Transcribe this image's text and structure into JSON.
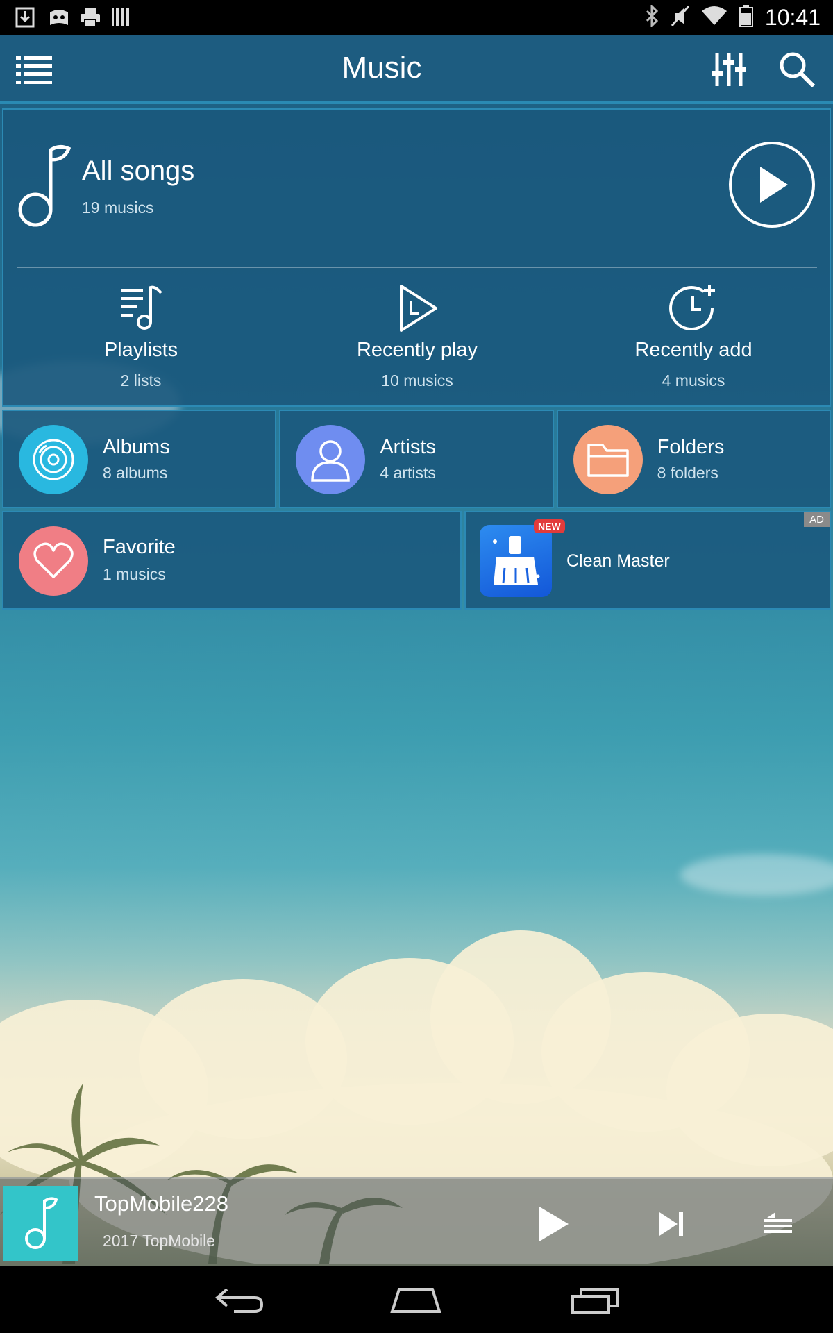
{
  "status_bar": {
    "time": "10:41",
    "left_icons": [
      "download-icon",
      "game-icon",
      "print-icon",
      "barcode-icon"
    ],
    "right_icons": [
      "bluetooth-icon",
      "mute-icon",
      "wifi-icon",
      "battery-icon"
    ]
  },
  "app_bar": {
    "title": "Music",
    "menu_icon": "list-menu-icon",
    "equalizer_icon": "equalizer-icon",
    "search_icon": "search-icon"
  },
  "all_songs": {
    "title": "All songs",
    "count": "19 musics"
  },
  "quick_links": [
    {
      "label": "Playlists",
      "count": "2 lists",
      "icon": "playlist-icon"
    },
    {
      "label": "Recently play",
      "count": "10 musics",
      "icon": "recent-play-icon"
    },
    {
      "label": "Recently add",
      "count": "4 musics",
      "icon": "recent-add-icon"
    }
  ],
  "tiles": [
    {
      "label": "Albums",
      "count": "8 albums",
      "icon": "album-disc-icon",
      "color": "#29b8e0"
    },
    {
      "label": "Artists",
      "count": "4 artists",
      "icon": "artist-person-icon",
      "color": "#6f8df0"
    },
    {
      "label": "Folders",
      "count": "8 folders",
      "icon": "folder-icon",
      "color": "#f5a07a"
    }
  ],
  "favorite": {
    "label": "Favorite",
    "count": "1 musics",
    "icon": "heart-icon",
    "color": "#f07e85"
  },
  "ad": {
    "name": "Clean Master",
    "badge": "NEW",
    "tag": "AD",
    "icon": "broom-icon"
  },
  "now_playing": {
    "title": "TopMobile228",
    "subtitle": "2017 TopMobile"
  },
  "colors": {
    "app_bar": "#1d5c80",
    "card_border": "#2c8ab4",
    "accent_teal": "#33c5c9"
  }
}
